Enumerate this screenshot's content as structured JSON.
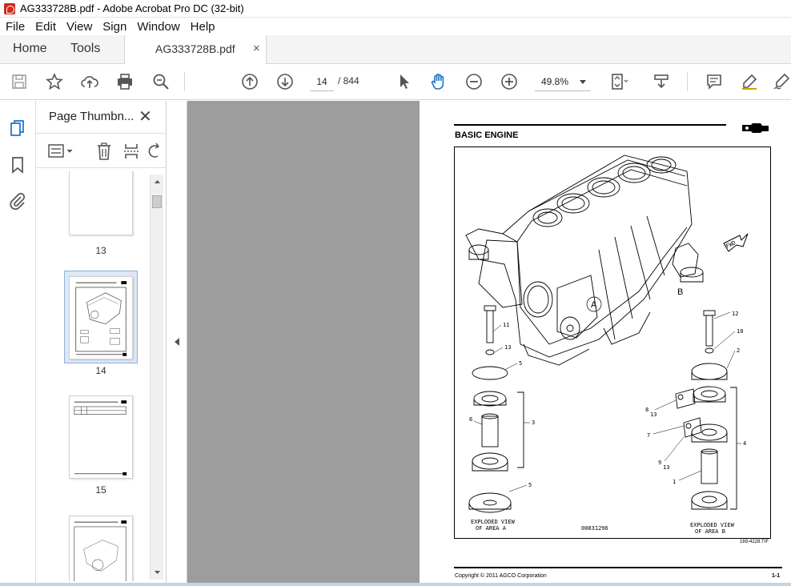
{
  "window": {
    "title": "AG333728B.pdf - Adobe Acrobat Pro DC (32-bit)"
  },
  "menu": [
    "File",
    "Edit",
    "View",
    "Sign",
    "Window",
    "Help"
  ],
  "tabs": {
    "home": "Home",
    "tools": "Tools",
    "document": "AG333728B.pdf",
    "close": "×"
  },
  "toolbar": {
    "page_current": "14",
    "page_total": "/ 844",
    "zoom": "49.8%"
  },
  "thumbnails_panel": {
    "title": "Page Thumbn...",
    "close": "✕",
    "pages": [
      {
        "label": "13"
      },
      {
        "label": "14",
        "selected": true
      },
      {
        "label": "15"
      }
    ]
  },
  "document_page": {
    "section_title": "BASIC ENGINE",
    "figure": {
      "callouts": [
        "A",
        "B",
        "FWD",
        "11",
        "13",
        "5",
        "6",
        "3",
        "5",
        "12",
        "10",
        "2",
        "8",
        "13",
        "7",
        "9",
        "13",
        "1",
        "4"
      ],
      "caption_a": "EXPLODED VIEW\nOF AREA A",
      "caption_a_line1": "EXPLODED VIEW",
      "caption_a_line2": "OF AREA A",
      "caption_b_line1": "EXPLODED VIEW",
      "caption_b_line2": "OF AREA B",
      "part_number": "00831296"
    },
    "figure_ref": "169-4228.TIF",
    "copyright": "Copyright © 2011 AGCO Corporation",
    "page_number": "1-1"
  },
  "colors": {
    "accent": "#1a73c9",
    "doc_background": "#9d9d9d",
    "selected_thumb": "#dce8f5"
  }
}
